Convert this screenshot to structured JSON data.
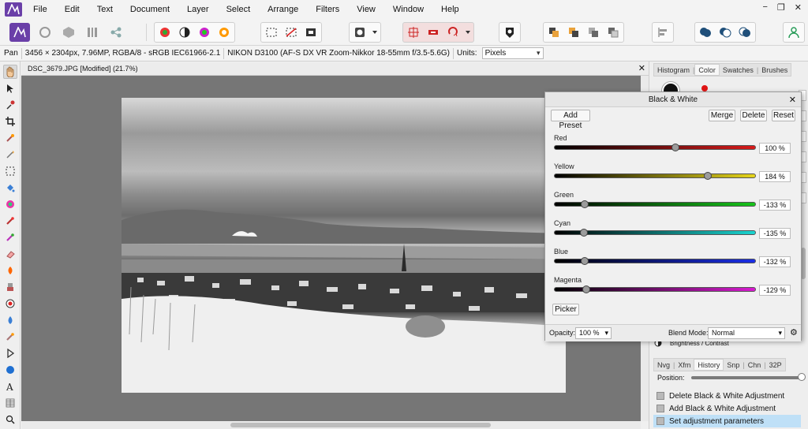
{
  "menu": {
    "items": [
      "File",
      "Edit",
      "Text",
      "Document",
      "Layer",
      "Select",
      "Arrange",
      "Filters",
      "View",
      "Window",
      "Help"
    ],
    "window_controls": [
      "−",
      "❐",
      "✕"
    ]
  },
  "context": {
    "tool_name": "Pan",
    "image_info": "3456 × 2304px, 7.96MP, RGBA/8 - sRGB IEC61966-2.1",
    "camera_info": "NIKON D3100 (AF-S DX VR Zoom-Nikkor 18-55mm f/3.5-5.6G)",
    "units_label": "Units:",
    "units_value": "Pixels"
  },
  "document": {
    "tab_title": "DSC_3679.JPG [Modified] (21.7%)",
    "close_glyph": "✕"
  },
  "right_panel": {
    "top_tabs": [
      "Histogram",
      "Color",
      "Swatches",
      "Brushes"
    ],
    "active_top_tab": "Color",
    "adjustment_item": "Brightness / Contrast",
    "bottom_tabs": [
      "Nvg",
      "Xfm",
      "History",
      "Snp",
      "Chn",
      "32P"
    ],
    "active_bottom_tab": "History",
    "position_label": "Position:",
    "position_fraction": 1.0,
    "history_items": [
      {
        "label": "Delete Black & White Adjustment",
        "selected": false
      },
      {
        "label": "Add Black & White Adjustment",
        "selected": false
      },
      {
        "label": "Set adjustment parameters",
        "selected": true
      }
    ]
  },
  "dialog": {
    "title": "Black & White",
    "add_preset": "Add Preset",
    "merge": "Merge",
    "delete": "Delete",
    "reset": "Reset",
    "picker": "Picker",
    "opacity_label": "Opacity:",
    "opacity_value": "100 %",
    "blend_label": "Blend Mode:",
    "blend_value": "Normal",
    "sliders": [
      {
        "label": "Red",
        "value": "100 %",
        "level": 100,
        "color": "#d81b1b"
      },
      {
        "label": "Yellow",
        "value": "184 %",
        "level": 184,
        "color": "#e6d51a"
      },
      {
        "label": "Green",
        "value": "-133 %",
        "level": -133,
        "color": "#16c41a"
      },
      {
        "label": "Cyan",
        "value": "-135 %",
        "level": -135,
        "color": "#1ad4d0"
      },
      {
        "label": "Blue",
        "value": "-132 %",
        "level": -132,
        "color": "#1a2ee6"
      },
      {
        "label": "Magenta",
        "value": "-129 %",
        "level": -129,
        "color": "#d81bd0"
      }
    ],
    "slider_range": [
      -200,
      300
    ]
  },
  "colors": {
    "accent_purple": "#6a3fa8",
    "selection_blue": "#bfe0f7"
  }
}
